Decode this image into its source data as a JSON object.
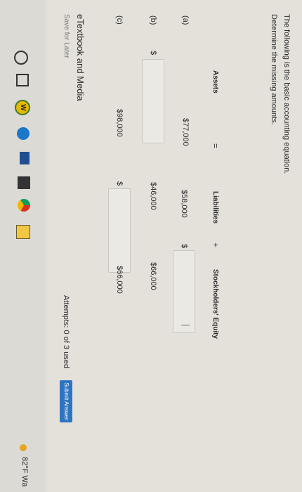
{
  "question": {
    "intro": "The following is the basic accounting equation.",
    "instruction": "Determine the missing amounts."
  },
  "table": {
    "headers": {
      "assets": "Assets",
      "equals": "=",
      "liabilities": "Liabilities",
      "plus": "+",
      "stockholders_equity": "Stockholders' Equity"
    },
    "rows": [
      {
        "label": "(a)",
        "assets": "$77,000",
        "liabilities": "$58,000",
        "se_dollar": "$",
        "se_input": ""
      },
      {
        "label": "(b)",
        "assets_dollar": "$",
        "assets_input": "",
        "liabilities": "$46,000",
        "se": "$66,000"
      },
      {
        "label": "(c)",
        "assets": "$98,000",
        "liabilities_dollar": "$",
        "liabilities_input": "",
        "se": "$66,000"
      }
    ]
  },
  "footer": {
    "etextbook": "eTextbook and Media",
    "save_later": "Save for Later",
    "attempts": "Attempts: 0 of 3 used",
    "submit": "Submit Answer"
  },
  "taskbar": {
    "weather": "82°F Wa"
  }
}
